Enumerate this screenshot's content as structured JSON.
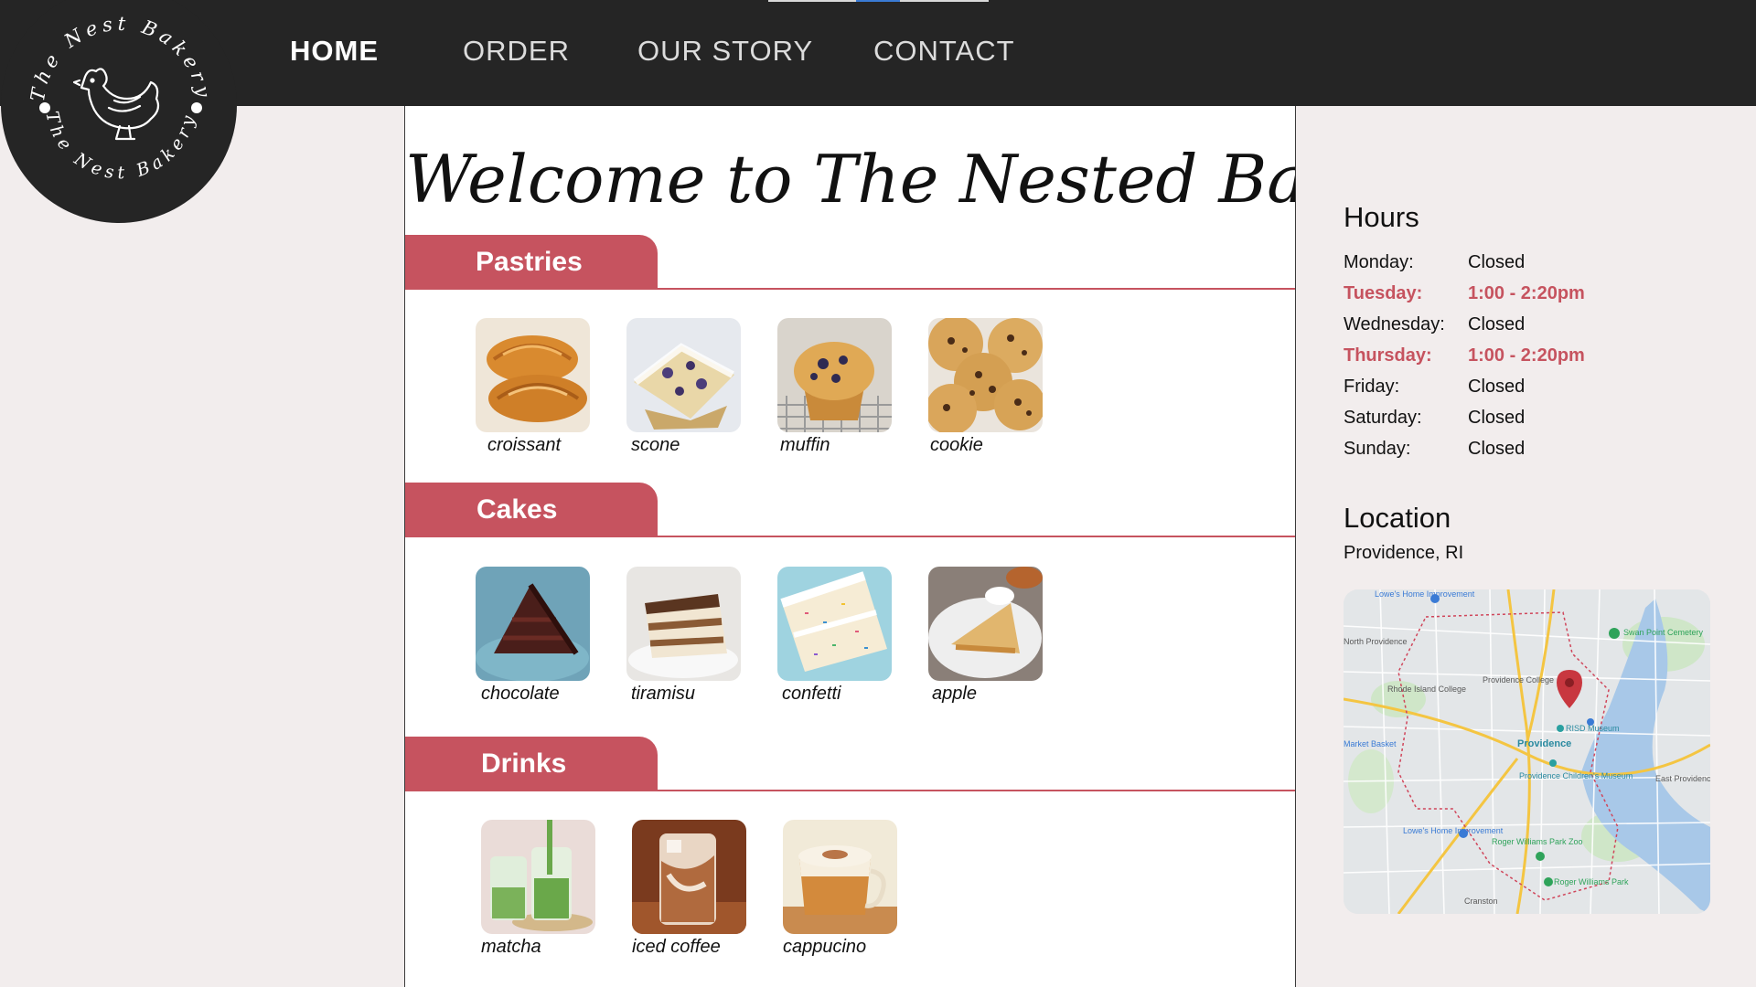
{
  "nav": {
    "items": [
      {
        "label": "HOME",
        "active": true
      },
      {
        "label": "ORDER",
        "active": false
      },
      {
        "label": "OUR STORY",
        "active": false
      },
      {
        "label": "CONTACT",
        "active": false
      }
    ]
  },
  "logo": {
    "text": "The Nest Bakery"
  },
  "main": {
    "welcome": "Welcome to The Nested Bakery",
    "sections": [
      {
        "title": "Pastries",
        "items": [
          "croissant",
          "scone",
          "muffin",
          "cookie"
        ]
      },
      {
        "title": "Cakes",
        "items": [
          "chocolate",
          "tiramisu",
          "confetti",
          "apple"
        ]
      },
      {
        "title": "Drinks",
        "items": [
          "matcha",
          "iced coffee",
          "cappucino"
        ]
      }
    ]
  },
  "sidebar": {
    "hours_title": "Hours",
    "hours": [
      {
        "day": "Monday:",
        "time": "Closed",
        "open": false
      },
      {
        "day": "Tuesday:",
        "time": "1:00 - 2:20pm",
        "open": true
      },
      {
        "day": "Wednesday:",
        "time": "Closed",
        "open": false
      },
      {
        "day": "Thursday:",
        "time": "1:00 - 2:20pm",
        "open": true
      },
      {
        "day": "Friday:",
        "time": "Closed",
        "open": false
      },
      {
        "day": "Saturday:",
        "time": "Closed",
        "open": false
      },
      {
        "day": "Sunday:",
        "time": "Closed",
        "open": false
      }
    ],
    "location_title": "Location",
    "location": "Providence, RI",
    "map_labels": {
      "lowes_top": "Lowe's Home Improvement",
      "north_providence": "North Providence",
      "swan_point": "Swan Point Cemetery",
      "rhode_island_college": "Rhode Island College",
      "providence_college": "Providence College",
      "risd_museum": "RISD Museum",
      "market_basket": "Market Basket",
      "providence": "Providence",
      "childrens_museum": "Providence Children's Museum",
      "east_providence": "East Providence",
      "lowes_bottom": "Lowe's Home Improvement",
      "roger_williams_zoo": "Roger Williams Park Zoo",
      "roger_williams_park": "Roger Williams Park",
      "cranston": "Cranston"
    }
  },
  "colors": {
    "accent": "#c6535f",
    "bar": "#252525",
    "page": "#f2eded"
  }
}
